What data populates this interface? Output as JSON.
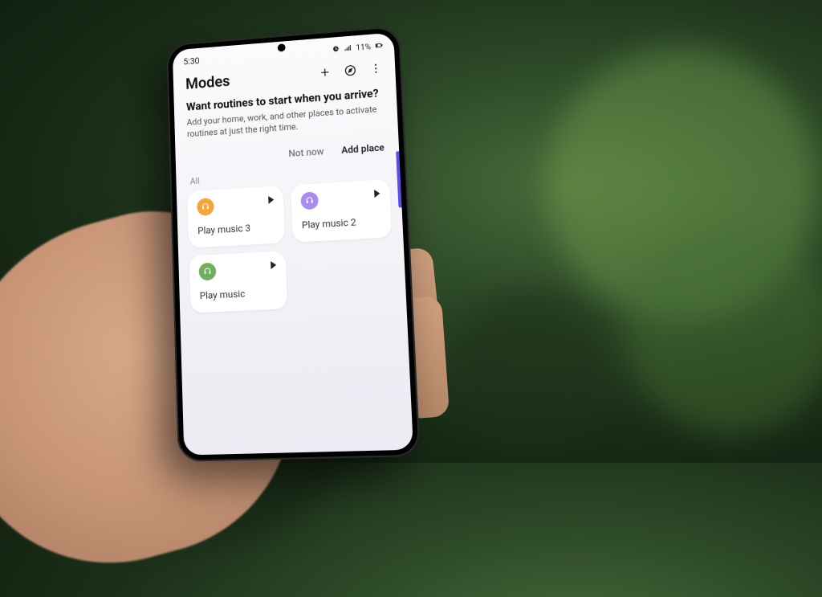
{
  "status": {
    "time": "5:30",
    "battery_text": "11%"
  },
  "header": {
    "title": "Modes"
  },
  "prompt": {
    "title": "Want routines to start when you arrive?",
    "body": "Add your home, work, and other places to activate routines at just the right time.",
    "dismiss_label": "Not now",
    "confirm_label": "Add place"
  },
  "section_label": "All",
  "tiles": [
    {
      "label": "Play music 3",
      "icon_color": "orange"
    },
    {
      "label": "Play music 2",
      "icon_color": "purple"
    },
    {
      "label": "Play music",
      "icon_color": "green"
    }
  ],
  "colors": {
    "accent": "#5b4de6"
  }
}
